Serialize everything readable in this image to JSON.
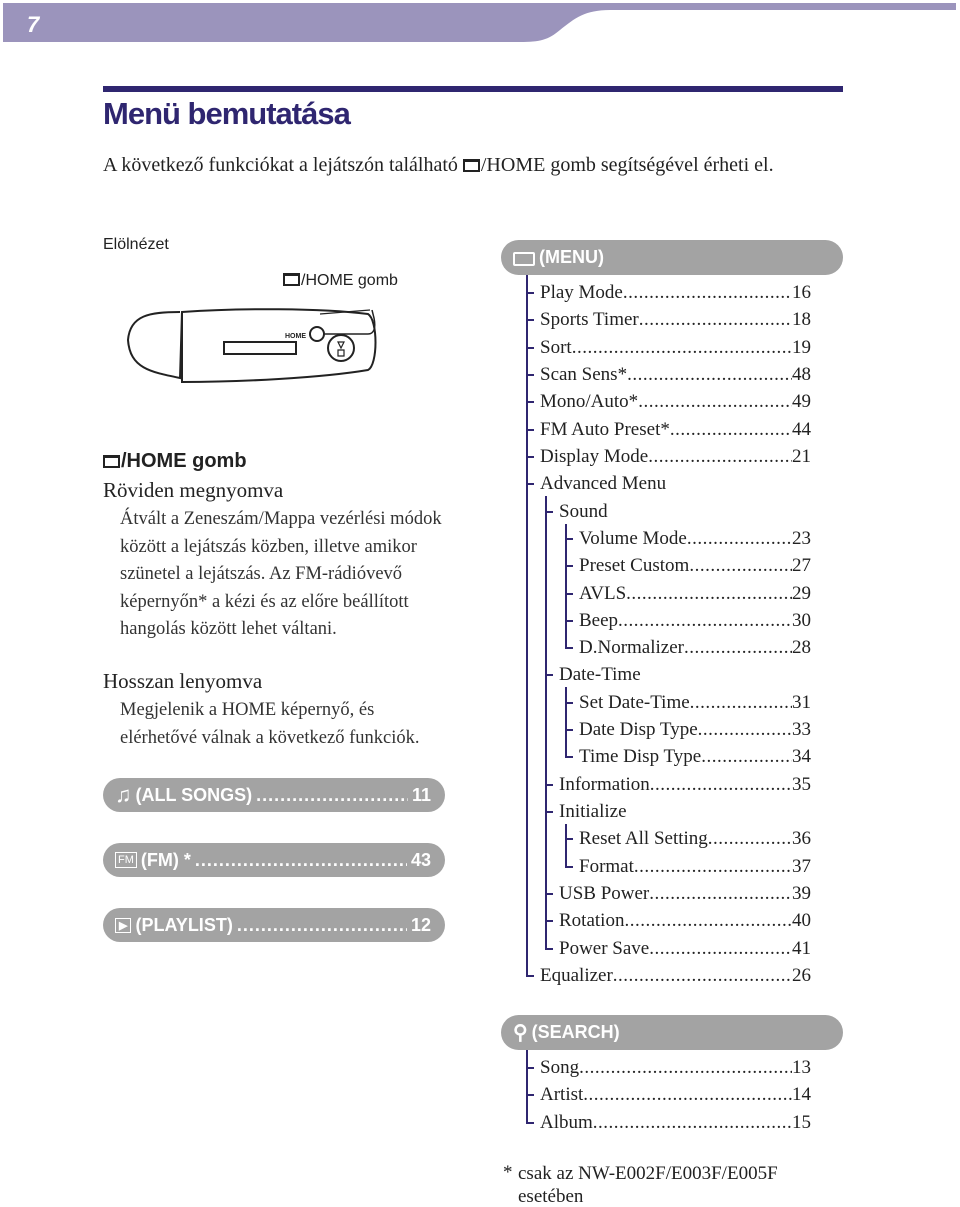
{
  "page_number": "7",
  "colors": {
    "header_band": "#9b94bc",
    "accent": "#2f2670",
    "pill": "#a3a3a3"
  },
  "title": "Menü bemutatása",
  "intro": {
    "before": "A következő funkciókat a lejátszón található ",
    "after": "/HOME gomb segítségével érheti el."
  },
  "front_view_label": "Elölnézet",
  "callout_label": "/HOME gomb",
  "device_home_label": "HOME",
  "section_title": "/HOME gomb",
  "short_press": {
    "heading": "Röviden megnyomva",
    "text": "Átvált a Zeneszám/Mappa vezérlési módok között a lejátszás közben, illetve amikor szünetel a lejátszás. Az FM-rádióvevő képernyőn* a kézi és az előre beállított hangolás között lehet váltani."
  },
  "long_press": {
    "heading": "Hosszan lenyomva",
    "text": "Megjelenik a HOME képernyő, és elérhetővé válnak a következő funkciók."
  },
  "left_pills": [
    {
      "icon": "music-note-icon",
      "label": "(ALL SONGS)",
      "page": "11"
    },
    {
      "icon": "fm-icon",
      "label": "(FM) *",
      "page": "43"
    },
    {
      "icon": "playlist-icon",
      "label": "(PLAYLIST)",
      "page": "12"
    }
  ],
  "menu": {
    "icon": "toolbox-icon",
    "label": "(MENU)",
    "items": [
      {
        "label": "Play Mode",
        "page": "16",
        "level": 0
      },
      {
        "label": "Sports Timer",
        "page": "18",
        "level": 0
      },
      {
        "label": "Sort",
        "page": "19",
        "level": 0
      },
      {
        "label": "Scan Sens*",
        "page": "48",
        "level": 0
      },
      {
        "label": "Mono/Auto*",
        "page": "49",
        "level": 0
      },
      {
        "label": "FM Auto Preset*",
        "page": "44",
        "level": 0
      },
      {
        "label": "Display Mode",
        "page": "21",
        "level": 0
      },
      {
        "label": "Advanced Menu",
        "page": "",
        "level": 0
      },
      {
        "label": "Sound",
        "page": "",
        "level": 1
      },
      {
        "label": "Volume Mode",
        "page": "23",
        "level": 2
      },
      {
        "label": "Preset Custom",
        "page": "27",
        "level": 2
      },
      {
        "label": "AVLS",
        "page": "29",
        "level": 2
      },
      {
        "label": "Beep",
        "page": "30",
        "level": 2
      },
      {
        "label": "D.Normalizer",
        "page": "28",
        "level": 2
      },
      {
        "label": "Date-Time",
        "page": "",
        "level": 1
      },
      {
        "label": "Set Date-Time",
        "page": "31",
        "level": 2
      },
      {
        "label": "Date Disp Type",
        "page": "33",
        "level": 2
      },
      {
        "label": "Time Disp Type",
        "page": "34",
        "level": 2
      },
      {
        "label": "Information",
        "page": "35",
        "level": 1
      },
      {
        "label": "Initialize",
        "page": "",
        "level": 1
      },
      {
        "label": "Reset All Setting",
        "page": "36",
        "level": 2
      },
      {
        "label": "Format",
        "page": "37",
        "level": 2
      },
      {
        "label": "USB Power",
        "page": "39",
        "level": 1
      },
      {
        "label": "Rotation",
        "page": "40",
        "level": 1
      },
      {
        "label": "Power Save",
        "page": "41",
        "level": 1
      },
      {
        "label": "Equalizer",
        "page": "26",
        "level": 0
      }
    ]
  },
  "search": {
    "icon": "search-icon",
    "label": "(SEARCH)",
    "items": [
      {
        "label": "Song",
        "page": "13",
        "level": 0
      },
      {
        "label": "Artist",
        "page": "14",
        "level": 0
      },
      {
        "label": "Album",
        "page": "15",
        "level": 0
      }
    ]
  },
  "footnote": {
    "mark": "*",
    "text": "csak az NW-E002F/E003F/E005F esetében"
  }
}
